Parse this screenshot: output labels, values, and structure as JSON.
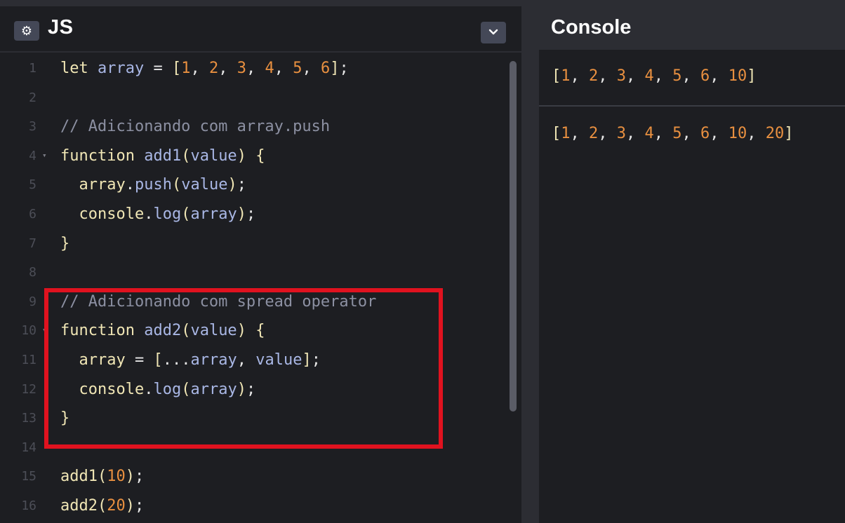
{
  "editor": {
    "title": "JS",
    "gear_icon": "⚙",
    "collapse_icon": "⌄",
    "lines": [
      {
        "n": "1",
        "tokens": [
          [
            "kw",
            "let "
          ],
          [
            "vr",
            "array"
          ],
          [
            "pl",
            " = "
          ],
          [
            "br",
            "["
          ],
          [
            "num",
            "1"
          ],
          [
            "pl",
            ", "
          ],
          [
            "num",
            "2"
          ],
          [
            "pl",
            ", "
          ],
          [
            "num",
            "3"
          ],
          [
            "pl",
            ", "
          ],
          [
            "num",
            "4"
          ],
          [
            "pl",
            ", "
          ],
          [
            "num",
            "5"
          ],
          [
            "pl",
            ", "
          ],
          [
            "num",
            "6"
          ],
          [
            "br",
            "]"
          ],
          [
            "pl",
            ";"
          ]
        ]
      },
      {
        "n": "2",
        "tokens": []
      },
      {
        "n": "3",
        "tokens": [
          [
            "cm",
            "// Adicionando com array.push"
          ]
        ]
      },
      {
        "n": "4",
        "fold": true,
        "tokens": [
          [
            "kw",
            "function "
          ],
          [
            "fn",
            "add1"
          ],
          [
            "br",
            "("
          ],
          [
            "vr",
            "value"
          ],
          [
            "br",
            ")"
          ],
          [
            "pl",
            " "
          ],
          [
            "br",
            "{"
          ]
        ]
      },
      {
        "n": "5",
        "tokens": [
          [
            "pl",
            "  "
          ],
          [
            "kw",
            "array"
          ],
          [
            "pl",
            "."
          ],
          [
            "fn",
            "push"
          ],
          [
            "br",
            "("
          ],
          [
            "vr",
            "value"
          ],
          [
            "br",
            ")"
          ],
          [
            "pl",
            ";"
          ]
        ]
      },
      {
        "n": "6",
        "tokens": [
          [
            "pl",
            "  "
          ],
          [
            "kw",
            "console"
          ],
          [
            "pl",
            "."
          ],
          [
            "fn",
            "log"
          ],
          [
            "br",
            "("
          ],
          [
            "vr",
            "array"
          ],
          [
            "br",
            ")"
          ],
          [
            "pl",
            ";"
          ]
        ]
      },
      {
        "n": "7",
        "tokens": [
          [
            "br",
            "}"
          ]
        ]
      },
      {
        "n": "8",
        "tokens": []
      },
      {
        "n": "9",
        "tokens": [
          [
            "cm",
            "// Adicionando com spread operator"
          ]
        ]
      },
      {
        "n": "10",
        "fold": true,
        "tokens": [
          [
            "kw",
            "function "
          ],
          [
            "fn",
            "add2"
          ],
          [
            "br",
            "("
          ],
          [
            "vr",
            "value"
          ],
          [
            "br",
            ")"
          ],
          [
            "pl",
            " "
          ],
          [
            "br",
            "{"
          ]
        ]
      },
      {
        "n": "11",
        "tokens": [
          [
            "pl",
            "  "
          ],
          [
            "kw",
            "array"
          ],
          [
            "pl",
            " = "
          ],
          [
            "br",
            "["
          ],
          [
            "pl",
            "..."
          ],
          [
            "vr",
            "array"
          ],
          [
            "pl",
            ", "
          ],
          [
            "vr",
            "value"
          ],
          [
            "br",
            "]"
          ],
          [
            "pl",
            ";"
          ]
        ]
      },
      {
        "n": "12",
        "tokens": [
          [
            "pl",
            "  "
          ],
          [
            "kw",
            "console"
          ],
          [
            "pl",
            "."
          ],
          [
            "fn",
            "log"
          ],
          [
            "br",
            "("
          ],
          [
            "vr",
            "array"
          ],
          [
            "br",
            ")"
          ],
          [
            "pl",
            ";"
          ]
        ]
      },
      {
        "n": "13",
        "tokens": [
          [
            "br",
            "}"
          ]
        ]
      },
      {
        "n": "14",
        "tokens": []
      },
      {
        "n": "15",
        "tokens": [
          [
            "kw",
            "add1"
          ],
          [
            "br",
            "("
          ],
          [
            "num",
            "10"
          ],
          [
            "br",
            ")"
          ],
          [
            "pl",
            ";"
          ]
        ]
      },
      {
        "n": "16",
        "tokens": [
          [
            "kw",
            "add2"
          ],
          [
            "br",
            "("
          ],
          [
            "num",
            "20"
          ],
          [
            "br",
            ")"
          ],
          [
            "pl",
            ";"
          ]
        ]
      }
    ]
  },
  "console": {
    "title": "Console",
    "outputs": [
      [
        [
          "br",
          "["
        ],
        [
          "num",
          "1"
        ],
        [
          "pl",
          ", "
        ],
        [
          "num",
          "2"
        ],
        [
          "pl",
          ", "
        ],
        [
          "num",
          "3"
        ],
        [
          "pl",
          ", "
        ],
        [
          "num",
          "4"
        ],
        [
          "pl",
          ", "
        ],
        [
          "num",
          "5"
        ],
        [
          "pl",
          ", "
        ],
        [
          "num",
          "6"
        ],
        [
          "pl",
          ", "
        ],
        [
          "num",
          "10"
        ],
        [
          "br",
          "]"
        ]
      ],
      [
        [
          "br",
          "["
        ],
        [
          "num",
          "1"
        ],
        [
          "pl",
          ", "
        ],
        [
          "num",
          "2"
        ],
        [
          "pl",
          ", "
        ],
        [
          "num",
          "3"
        ],
        [
          "pl",
          ", "
        ],
        [
          "num",
          "4"
        ],
        [
          "pl",
          ", "
        ],
        [
          "num",
          "5"
        ],
        [
          "pl",
          ", "
        ],
        [
          "num",
          "6"
        ],
        [
          "pl",
          ", "
        ],
        [
          "num",
          "10"
        ],
        [
          "pl",
          ", "
        ],
        [
          "num",
          "20"
        ],
        [
          "br",
          "]"
        ]
      ]
    ]
  },
  "colors": {
    "background": "#1d1e22",
    "header": "#2c2d33",
    "highlight": "#e0121f",
    "number": "#e99040",
    "comment": "#8c90a2",
    "keyword": "#f0e6b5",
    "function": "#a9b7e5"
  }
}
